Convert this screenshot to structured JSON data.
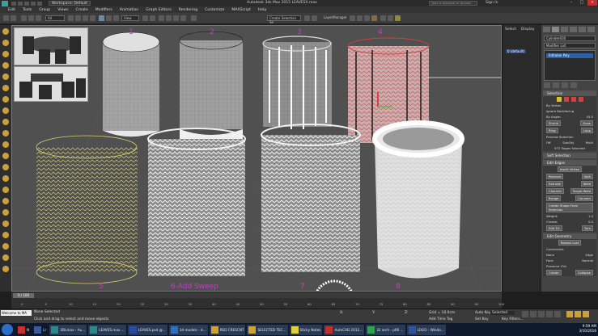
{
  "window": {
    "title": "Autodesk 3ds Max 2015  LEAVESX.max",
    "workspace": "Workspace: Default",
    "search_placeholder": "Type a keyword or phrase",
    "sign_in": "Sign In"
  },
  "menu": [
    "Edit",
    "Tools",
    "Group",
    "Views",
    "Create",
    "Modifiers",
    "Animation",
    "Graph Editors",
    "Rendering",
    "Customize",
    "MAXScript",
    "Help"
  ],
  "toolbar": {
    "filter_select": "All",
    "view_select": "View",
    "named_selection": "Create Selection Se",
    "layer_label": "LayerManager"
  },
  "viewport": {
    "labels": [
      "1",
      "2",
      "3",
      "4",
      "5",
      "6-Add Sweep",
      "7",
      "8"
    ]
  },
  "explorer": {
    "tab_select": "Select",
    "tab_display": "Display",
    "layer_item": "0 (default)"
  },
  "command_panel": {
    "object_name": "Cylinder030",
    "modifier_list": "Modifier List",
    "stack_item": "Editable Poly",
    "selection": {
      "title": "Selection",
      "by_vertex": "By Vertex",
      "ignore_backfacing": "Ignore Backfacing",
      "by_angle": "By Angle:",
      "by_angle_value": "45.0",
      "shrink": "Shrink",
      "grow": "Grow",
      "ring": "Ring",
      "loop": "Loop",
      "preview_selection": "Preview Selection",
      "off": "Off",
      "subobj": "SubObj",
      "multi": "Multi",
      "selected_count": "972 Edges Selected"
    },
    "soft_selection": "Soft Selection",
    "edit_edges": {
      "title": "Edit Edges",
      "insert_vertex": "Insert Vertex",
      "remove": "Remove",
      "split": "Split",
      "extrude": "Extrude",
      "weld": "Weld",
      "chamfer": "Chamfer",
      "target_weld": "Target Weld",
      "bridge": "Bridge",
      "connect": "Connect",
      "create_shape": "Create Shape From Selection",
      "weight": "Weight:",
      "weight_value": "1.0",
      "crease": "Crease:",
      "crease_value": "0.0",
      "edit_tri": "Edit Tri.",
      "turn": "Turn"
    },
    "edit_geometry": {
      "title": "Edit Geometry",
      "repeat_last": "Repeat Last",
      "constraints": "Constraints",
      "none": "None",
      "edge": "Edge",
      "face": "Face",
      "normal": "Normal",
      "preserve_uvs": "Preserve UVs",
      "create": "Create",
      "collapse": "Collapse"
    }
  },
  "timeline": {
    "slider": "0 / 100",
    "ticks": [
      "0",
      "5",
      "10",
      "15",
      "20",
      "25",
      "30",
      "35",
      "40",
      "45",
      "50",
      "55",
      "60",
      "65",
      "70",
      "75",
      "80",
      "85",
      "90",
      "95",
      "100"
    ]
  },
  "status": {
    "maxscript": "Welcome to MA",
    "line1": "None Selected",
    "line2": "Click and drag to select and move objects",
    "x_label": "X:",
    "y_label": "Y:",
    "z_label": "Z:",
    "grid": "Grid = 10.0cm",
    "add_time_tag": "Add Time Tag",
    "auto_key": "Auto Key",
    "auto_key_value": "Selected",
    "set_key": "Set Key",
    "key_filters": "Key Filters..."
  },
  "taskbar": {
    "tasks": [
      "N",
      "Lr",
      "3DLmax - Au...",
      "LEAVES.max ...",
      "LEAVES.psd @...",
      "3d models - d...",
      "RED CRESCNT",
      "SELECTED TEC...",
      "Sticky Notes",
      "AutoCAD 2012...",
      "32 arch - p06 ...",
      "LOGO - Windo..."
    ],
    "time": "9:59 AM",
    "date": "3/10/2016"
  },
  "colors": {
    "viewport_bg": "#505050",
    "label_magenta": "#c040c0",
    "selected_red": "#d04040",
    "wire_yellow": "#d8d070",
    "highlight_blue": "#2b5fa8"
  }
}
